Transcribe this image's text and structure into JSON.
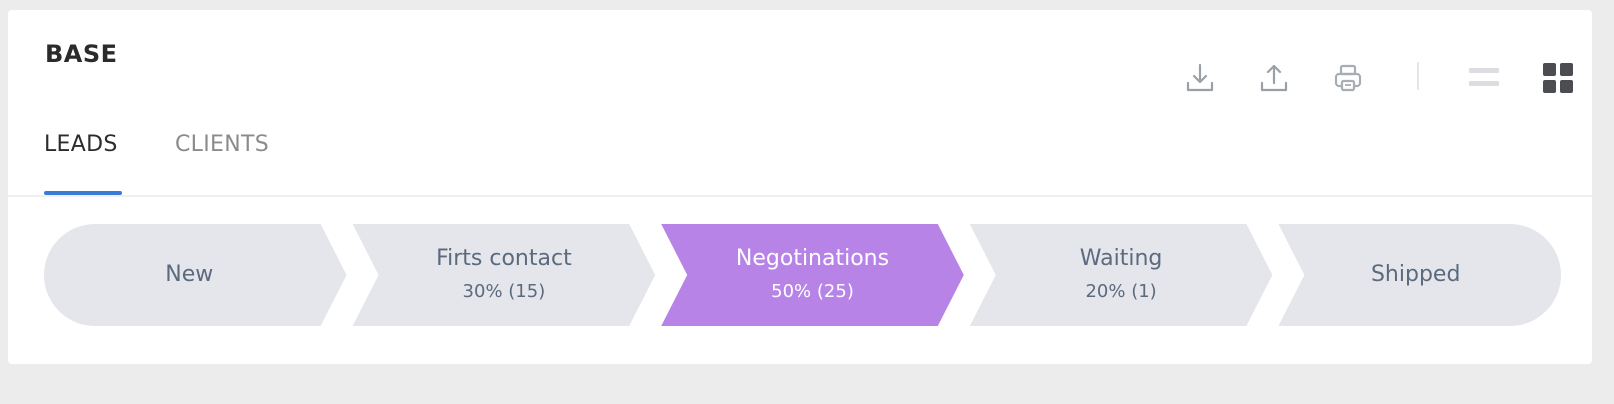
{
  "header": {
    "title": "BASE"
  },
  "toolbar": {
    "icons": [
      "download-icon",
      "upload-icon",
      "print-icon",
      "list-view-icon",
      "grid-view-icon"
    ]
  },
  "tabs": [
    {
      "label": "LEADS",
      "active": true
    },
    {
      "label": "CLIENTS",
      "active": false
    }
  ],
  "pipeline": {
    "stages": [
      {
        "name": "New",
        "meta": "",
        "active": false
      },
      {
        "name": "Firts contact",
        "meta": "30% (15)",
        "active": false
      },
      {
        "name": "Negotinations",
        "meta": "50% (25)",
        "active": true
      },
      {
        "name": "Waiting",
        "meta": "20% (1)",
        "active": false
      },
      {
        "name": "Shipped",
        "meta": "",
        "active": false
      }
    ]
  },
  "colors": {
    "page_background": "#ececed",
    "card_background": "#ffffff",
    "stage_default": "#e4e6eb",
    "stage_active": "#b783e6",
    "stage_text": "#5c6a7e",
    "stage_active_text": "#ffffff",
    "tab_underline": "#3a7bd5"
  }
}
